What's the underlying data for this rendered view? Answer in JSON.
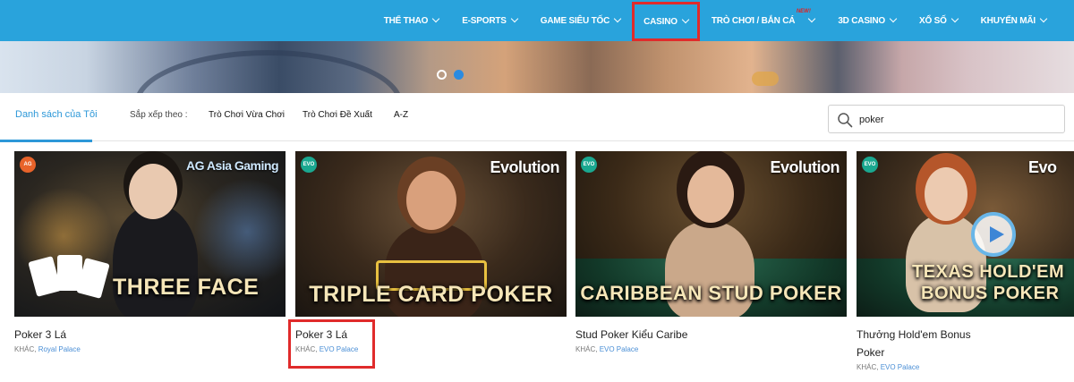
{
  "nav": {
    "items": [
      {
        "label": "THỂ THAO"
      },
      {
        "label": "E-SPORTS"
      },
      {
        "label": "GAME SIÊU TỐC"
      },
      {
        "label": "CASINO"
      },
      {
        "label": "TRÒ CHƠI / BẮN CÁ",
        "badge": "NEW!"
      },
      {
        "label": "3D CASINO"
      },
      {
        "label": "XỔ SỐ"
      },
      {
        "label": "KHUYẾN MÃI"
      }
    ],
    "active": "CASINO"
  },
  "filter": {
    "my_list": "Danh sách của Tôi",
    "sort_label": "Sắp xếp theo :",
    "sort_options": [
      "Trò Chơi Vừa Chơi",
      "Trò Chơi Đề Xuất",
      "A-Z"
    ]
  },
  "search": {
    "value": "poker",
    "icon": "search-icon"
  },
  "games": [
    {
      "title": "Poker 3 Lá",
      "category": "KHÁC",
      "provider": "Royal Palace",
      "badge": "AG",
      "logo": "AG Asia Gaming",
      "art": "THREE FACE",
      "badge_color": "#e8632a"
    },
    {
      "title": "Poker 3 Lá",
      "category": "KHÁC",
      "provider": "EVO Palace",
      "badge": "EVO",
      "logo": "Evolution",
      "art": "TRIPLE CARD POKER",
      "badge_color": "#1aa890"
    },
    {
      "title": "Stud Poker Kiểu Caribe",
      "category": "KHÁC",
      "provider": "EVO Palace",
      "badge": "EVO",
      "logo": "Evolution",
      "art": "CARIBBEAN STUD POKER",
      "badge_color": "#1aa890"
    },
    {
      "title": "Thưởng Hold'em Bonus Poker",
      "category": "KHÁC",
      "provider": "EVO Palace",
      "badge": "EVO",
      "logo": "Evo",
      "art": "TEXAS HOLD'EM",
      "art2": "BONUS POKER",
      "badge_color": "#1aa890"
    }
  ],
  "colors": {
    "nav_bg": "#29a3dc",
    "accent": "#2d98d8",
    "highlight": "#e02b2b"
  }
}
